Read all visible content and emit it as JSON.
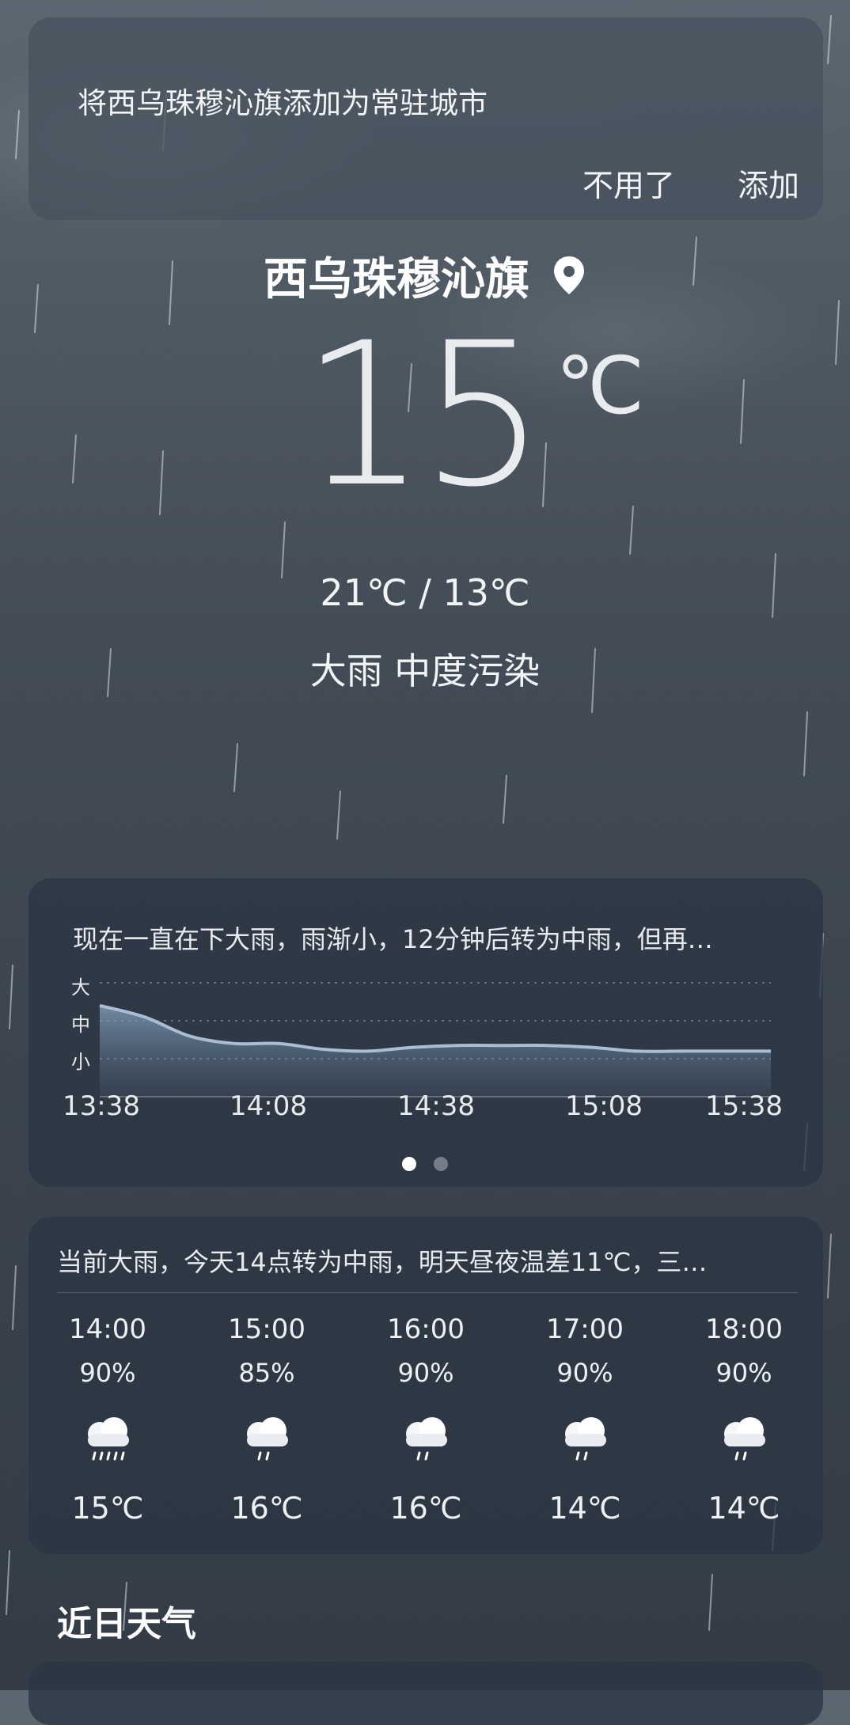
{
  "banner": {
    "message": "将西乌珠穆沁旗添加为常驻城市",
    "dismiss_label": "不用了",
    "add_label": "添加"
  },
  "current": {
    "city": "西乌珠穆沁旗",
    "temperature": "15",
    "unit": "℃",
    "range": "21℃ / 13℃",
    "condition": "大雨  中度污染"
  },
  "precip_card": {
    "summary": "现在一直在下大雨，雨渐小，12分钟后转为中雨，但再…",
    "levels": [
      "大",
      "中",
      "小"
    ],
    "time_labels": [
      "13:38",
      "14:08",
      "14:38",
      "15:08",
      "15:38"
    ],
    "pages": 2,
    "active_page": 1
  },
  "chart_data": {
    "type": "area",
    "x": [
      "13:38",
      "13:45",
      "13:50",
      "13:55",
      "14:00",
      "14:05",
      "14:10",
      "14:15",
      "14:20",
      "14:30",
      "14:40",
      "14:50",
      "15:00",
      "15:10",
      "15:20",
      "15:38"
    ],
    "y_levels": [
      "小",
      "中",
      "大"
    ],
    "values": [
      2.4,
      2.1,
      1.6,
      1.4,
      1.4,
      1.25,
      1.2,
      1.3,
      1.35,
      1.35,
      1.35,
      1.3,
      1.2,
      1.2,
      1.2,
      1.2
    ],
    "ylim": [
      0,
      3
    ]
  },
  "hourly_card": {
    "summary": "当前大雨，今天14点转为中雨，明天昼夜温差11℃，三…",
    "hours": [
      {
        "time": "14:00",
        "pop": "90%",
        "icon": "heavy-rain-icon",
        "temp": "15℃"
      },
      {
        "time": "15:00",
        "pop": "85%",
        "icon": "rain-icon",
        "temp": "16℃"
      },
      {
        "time": "16:00",
        "pop": "90%",
        "icon": "rain-icon",
        "temp": "16℃"
      },
      {
        "time": "17:00",
        "pop": "90%",
        "icon": "rain-icon",
        "temp": "14℃"
      },
      {
        "time": "18:00",
        "pop": "90%",
        "icon": "rain-icon",
        "temp": "14℃"
      }
    ]
  },
  "daily": {
    "title": "近日天气"
  }
}
